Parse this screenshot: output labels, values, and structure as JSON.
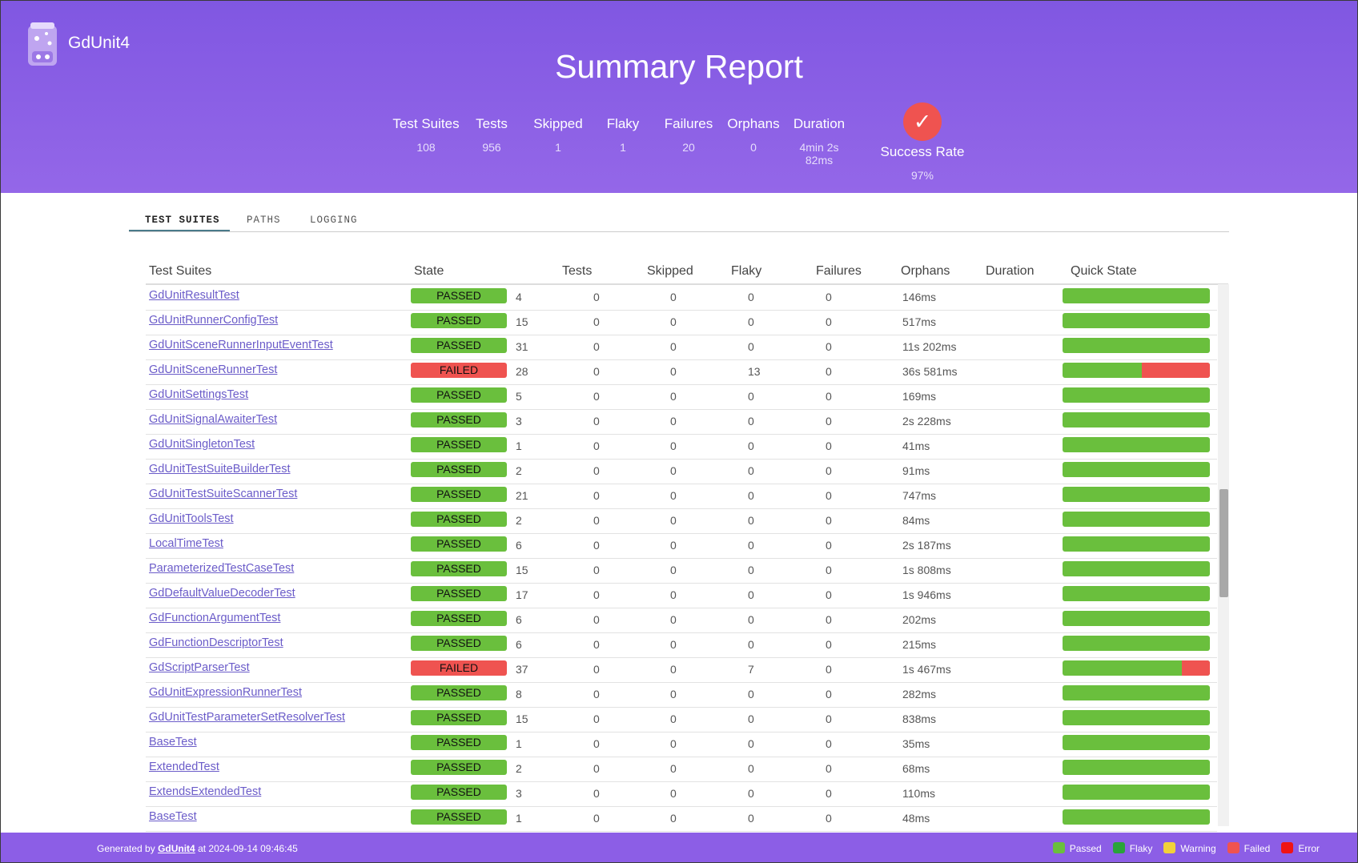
{
  "header": {
    "brand": "GdUnit4",
    "title": "Summary Report",
    "stats": [
      {
        "label": "Test Suites",
        "value": "108"
      },
      {
        "label": "Tests",
        "value": "956"
      },
      {
        "label": "Skipped",
        "value": "1"
      },
      {
        "label": "Flaky",
        "value": "1"
      },
      {
        "label": "Failures",
        "value": "20"
      },
      {
        "label": "Orphans",
        "value": "0"
      },
      {
        "label": "Duration",
        "value": "4min 2s 82ms"
      }
    ],
    "success": {
      "icon": "✓",
      "label": "Success Rate",
      "value": "97%"
    }
  },
  "tabs": [
    "TEST SUITES",
    "PATHS",
    "LOGGING"
  ],
  "table": {
    "columns": [
      "Test Suites",
      "State",
      "Tests",
      "Skipped",
      "Flaky",
      "Failures",
      "Orphans",
      "Duration",
      "Quick State"
    ],
    "rows": [
      {
        "name": "GdUnitResultTest",
        "state": "PASSED",
        "tests": "4",
        "skipped": "0",
        "flaky": "0",
        "failures": "0",
        "orphans": "0",
        "duration": "146ms"
      },
      {
        "name": "GdUnitRunnerConfigTest",
        "state": "PASSED",
        "tests": "15",
        "skipped": "0",
        "flaky": "0",
        "failures": "0",
        "orphans": "0",
        "duration": "517ms"
      },
      {
        "name": "GdUnitSceneRunnerInputEventTest",
        "state": "PASSED",
        "tests": "31",
        "skipped": "0",
        "flaky": "0",
        "failures": "0",
        "orphans": "0",
        "duration": "11s 202ms"
      },
      {
        "name": "GdUnitSceneRunnerTest",
        "state": "FAILED",
        "tests": "28",
        "skipped": "0",
        "flaky": "0",
        "failures": "13",
        "orphans": "0",
        "duration": "36s 581ms"
      },
      {
        "name": "GdUnitSettingsTest",
        "state": "PASSED",
        "tests": "5",
        "skipped": "0",
        "flaky": "0",
        "failures": "0",
        "orphans": "0",
        "duration": "169ms"
      },
      {
        "name": "GdUnitSignalAwaiterTest",
        "state": "PASSED",
        "tests": "3",
        "skipped": "0",
        "flaky": "0",
        "failures": "0",
        "orphans": "0",
        "duration": "2s 228ms"
      },
      {
        "name": "GdUnitSingletonTest",
        "state": "PASSED",
        "tests": "1",
        "skipped": "0",
        "flaky": "0",
        "failures": "0",
        "orphans": "0",
        "duration": "41ms"
      },
      {
        "name": "GdUnitTestSuiteBuilderTest",
        "state": "PASSED",
        "tests": "2",
        "skipped": "0",
        "flaky": "0",
        "failures": "0",
        "orphans": "0",
        "duration": "91ms"
      },
      {
        "name": "GdUnitTestSuiteScannerTest",
        "state": "PASSED",
        "tests": "21",
        "skipped": "0",
        "flaky": "0",
        "failures": "0",
        "orphans": "0",
        "duration": "747ms"
      },
      {
        "name": "GdUnitToolsTest",
        "state": "PASSED",
        "tests": "2",
        "skipped": "0",
        "flaky": "0",
        "failures": "0",
        "orphans": "0",
        "duration": "84ms"
      },
      {
        "name": "LocalTimeTest",
        "state": "PASSED",
        "tests": "6",
        "skipped": "0",
        "flaky": "0",
        "failures": "0",
        "orphans": "0",
        "duration": "2s 187ms"
      },
      {
        "name": "ParameterizedTestCaseTest",
        "state": "PASSED",
        "tests": "15",
        "skipped": "0",
        "flaky": "0",
        "failures": "0",
        "orphans": "0",
        "duration": "1s 808ms"
      },
      {
        "name": "GdDefaultValueDecoderTest",
        "state": "PASSED",
        "tests": "17",
        "skipped": "0",
        "flaky": "0",
        "failures": "0",
        "orphans": "0",
        "duration": "1s 946ms"
      },
      {
        "name": "GdFunctionArgumentTest",
        "state": "PASSED",
        "tests": "6",
        "skipped": "0",
        "flaky": "0",
        "failures": "0",
        "orphans": "0",
        "duration": "202ms"
      },
      {
        "name": "GdFunctionDescriptorTest",
        "state": "PASSED",
        "tests": "6",
        "skipped": "0",
        "flaky": "0",
        "failures": "0",
        "orphans": "0",
        "duration": "215ms"
      },
      {
        "name": "GdScriptParserTest",
        "state": "FAILED",
        "tests": "37",
        "skipped": "0",
        "flaky": "0",
        "failures": "7",
        "orphans": "0",
        "duration": "1s 467ms"
      },
      {
        "name": "GdUnitExpressionRunnerTest",
        "state": "PASSED",
        "tests": "8",
        "skipped": "0",
        "flaky": "0",
        "failures": "0",
        "orphans": "0",
        "duration": "282ms"
      },
      {
        "name": "GdUnitTestParameterSetResolverTest",
        "state": "PASSED",
        "tests": "15",
        "skipped": "0",
        "flaky": "0",
        "failures": "0",
        "orphans": "0",
        "duration": "838ms"
      },
      {
        "name": "BaseTest",
        "state": "PASSED",
        "tests": "1",
        "skipped": "0",
        "flaky": "0",
        "failures": "0",
        "orphans": "0",
        "duration": "35ms"
      },
      {
        "name": "ExtendedTest",
        "state": "PASSED",
        "tests": "2",
        "skipped": "0",
        "flaky": "0",
        "failures": "0",
        "orphans": "0",
        "duration": "68ms"
      },
      {
        "name": "ExtendsExtendedTest",
        "state": "PASSED",
        "tests": "3",
        "skipped": "0",
        "flaky": "0",
        "failures": "0",
        "orphans": "0",
        "duration": "110ms"
      },
      {
        "name": "BaseTest",
        "state": "PASSED",
        "tests": "1",
        "skipped": "0",
        "flaky": "0",
        "failures": "0",
        "orphans": "0",
        "duration": "48ms"
      }
    ]
  },
  "footer": {
    "generated_prefix": "Generated by",
    "generated_link": "GdUnit4",
    "generated_suffix": "at 2024-09-14 09:46:45",
    "legend": [
      {
        "label": "Passed",
        "color": "#6abf3d"
      },
      {
        "label": "Flaky",
        "color": "#2aa33a"
      },
      {
        "label": "Warning",
        "color": "#f2d13a"
      },
      {
        "label": "Failed",
        "color": "#ef5350"
      },
      {
        "label": "Error",
        "color": "#f01414"
      }
    ]
  },
  "colors": {
    "passed": "#6abf3d",
    "failed": "#ef5350",
    "header": "#8a5de5"
  }
}
